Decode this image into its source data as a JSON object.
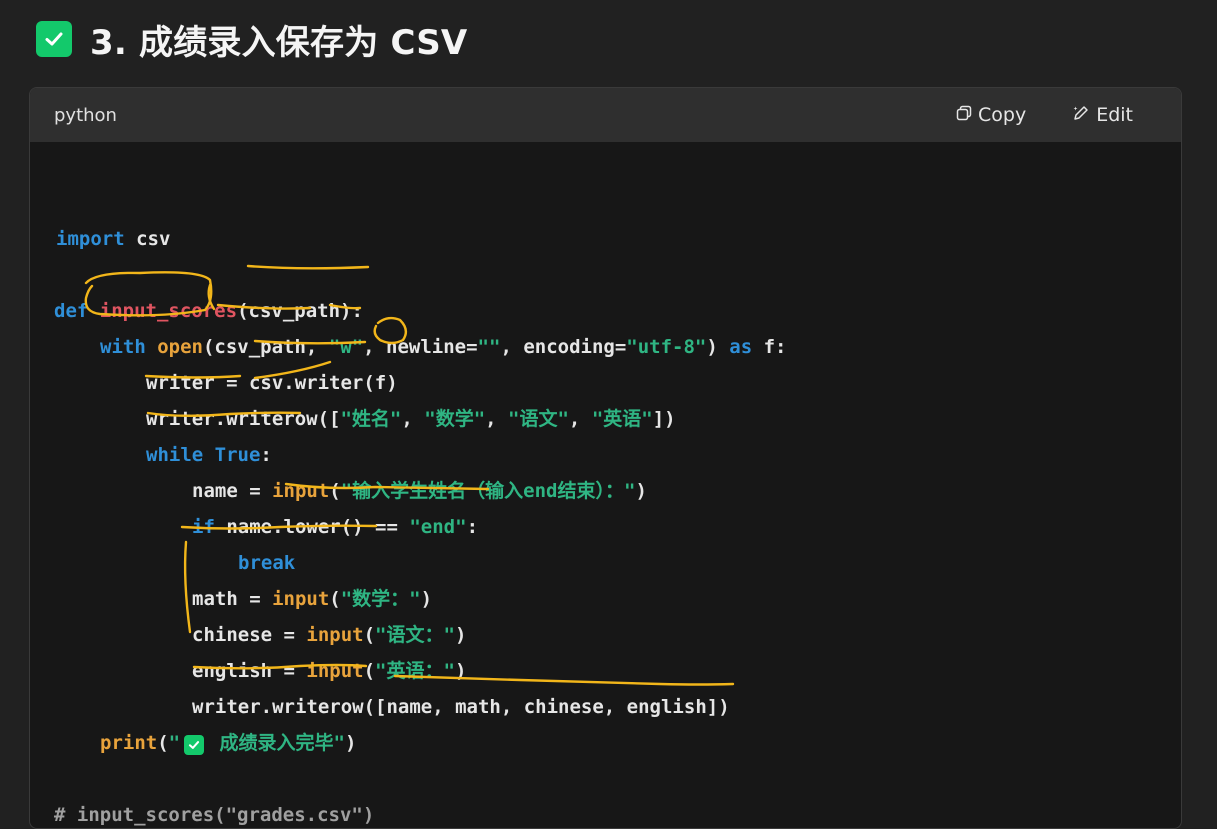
{
  "heading": {
    "text": "3. 成绩录入保存为 CSV"
  },
  "code_block": {
    "language": "python",
    "copy_label": "Copy",
    "edit_label": "Edit"
  },
  "code": {
    "l1": {
      "kw": "import",
      "rest": " csv"
    },
    "l3": {
      "kw": "def",
      "fn": "input_scores",
      "rest": "(csv_path):"
    },
    "l4": {
      "kw1": "with",
      "bi1": "open",
      "p1": "(csv_path, ",
      "s1": "\"w\"",
      "p2": ", newline=",
      "s2": "\"\"",
      "p3": ", encoding=",
      "s3": "\"utf-8\"",
      "p4": ") ",
      "kw2": "as",
      "p5": " f:"
    },
    "l5": {
      "text": "writer = csv.writer(f)"
    },
    "l6": {
      "p1": "writer.writerow([",
      "s1": "\"姓名\"",
      "c1": ", ",
      "s2": "\"数学\"",
      "c2": ", ",
      "s3": "\"语文\"",
      "c3": ", ",
      "s4": "\"英语\"",
      "p2": "])"
    },
    "l7": {
      "kw1": "while",
      "kw2": "True",
      "p1": ":"
    },
    "l8": {
      "p1": "name = ",
      "bi": "input",
      "p2": "(",
      "s": "\"输入学生姓名（输入end结束）：\"",
      "p3": ")"
    },
    "l9": {
      "kw": "if",
      "p1": " name.lower() == ",
      "s": "\"end\"",
      "p2": ":"
    },
    "l10": {
      "kw": "break"
    },
    "l11": {
      "p1": "math = ",
      "bi": "input",
      "p2": "(",
      "s": "\"数学：\"",
      "p3": ")"
    },
    "l12": {
      "p1": "chinese = ",
      "bi": "input",
      "p2": "(",
      "s": "\"语文：\"",
      "p3": ")"
    },
    "l13": {
      "p1": "english = ",
      "bi": "input",
      "p2": "(",
      "s": "\"英语：\"",
      "p3": ")"
    },
    "l14": {
      "text": "writer.writerow([name, math, chinese, english])"
    },
    "l15": {
      "bi": "print",
      "p1": "(",
      "s1": "\"",
      "s2": " 成绩录入完毕\"",
      "p2": ")"
    },
    "l17": {
      "cmt": "# input_scores(\"grades.csv\")"
    }
  },
  "colors": {
    "accent_green": "#13c96b",
    "keyword": "#2f8fd8",
    "function": "#e05561",
    "builtin": "#e8a33c",
    "string": "#2fb583",
    "annotation_ink": "#f2b61a"
  },
  "icons": [
    "check-square-icon",
    "copy-icon",
    "edit-pencil-icon"
  ]
}
